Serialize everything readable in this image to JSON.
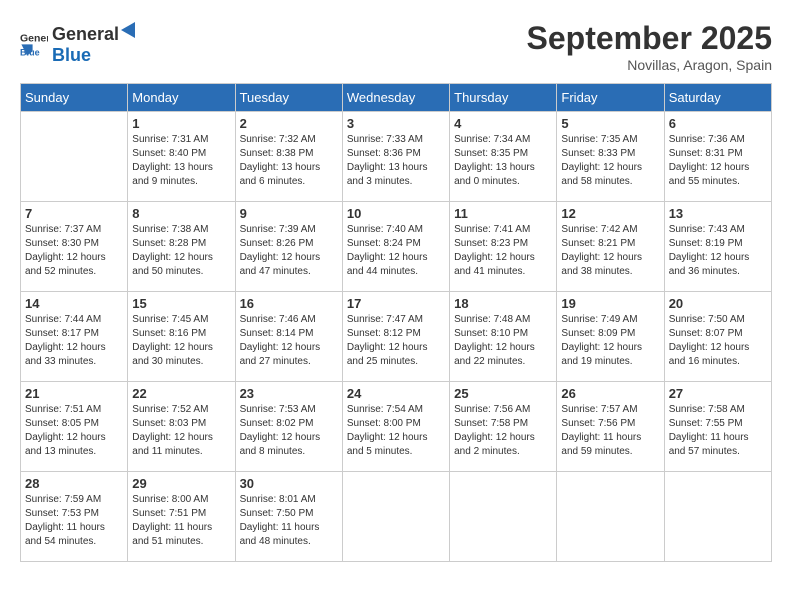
{
  "header": {
    "logo_general": "General",
    "logo_blue": "Blue",
    "month_title": "September 2025",
    "subtitle": "Novillas, Aragon, Spain"
  },
  "weekdays": [
    "Sunday",
    "Monday",
    "Tuesday",
    "Wednesday",
    "Thursday",
    "Friday",
    "Saturday"
  ],
  "weeks": [
    [
      {
        "day": "",
        "sunrise": "",
        "sunset": "",
        "daylight": ""
      },
      {
        "day": "1",
        "sunrise": "Sunrise: 7:31 AM",
        "sunset": "Sunset: 8:40 PM",
        "daylight": "Daylight: 13 hours and 9 minutes."
      },
      {
        "day": "2",
        "sunrise": "Sunrise: 7:32 AM",
        "sunset": "Sunset: 8:38 PM",
        "daylight": "Daylight: 13 hours and 6 minutes."
      },
      {
        "day": "3",
        "sunrise": "Sunrise: 7:33 AM",
        "sunset": "Sunset: 8:36 PM",
        "daylight": "Daylight: 13 hours and 3 minutes."
      },
      {
        "day": "4",
        "sunrise": "Sunrise: 7:34 AM",
        "sunset": "Sunset: 8:35 PM",
        "daylight": "Daylight: 13 hours and 0 minutes."
      },
      {
        "day": "5",
        "sunrise": "Sunrise: 7:35 AM",
        "sunset": "Sunset: 8:33 PM",
        "daylight": "Daylight: 12 hours and 58 minutes."
      },
      {
        "day": "6",
        "sunrise": "Sunrise: 7:36 AM",
        "sunset": "Sunset: 8:31 PM",
        "daylight": "Daylight: 12 hours and 55 minutes."
      }
    ],
    [
      {
        "day": "7",
        "sunrise": "Sunrise: 7:37 AM",
        "sunset": "Sunset: 8:30 PM",
        "daylight": "Daylight: 12 hours and 52 minutes."
      },
      {
        "day": "8",
        "sunrise": "Sunrise: 7:38 AM",
        "sunset": "Sunset: 8:28 PM",
        "daylight": "Daylight: 12 hours and 50 minutes."
      },
      {
        "day": "9",
        "sunrise": "Sunrise: 7:39 AM",
        "sunset": "Sunset: 8:26 PM",
        "daylight": "Daylight: 12 hours and 47 minutes."
      },
      {
        "day": "10",
        "sunrise": "Sunrise: 7:40 AM",
        "sunset": "Sunset: 8:24 PM",
        "daylight": "Daylight: 12 hours and 44 minutes."
      },
      {
        "day": "11",
        "sunrise": "Sunrise: 7:41 AM",
        "sunset": "Sunset: 8:23 PM",
        "daylight": "Daylight: 12 hours and 41 minutes."
      },
      {
        "day": "12",
        "sunrise": "Sunrise: 7:42 AM",
        "sunset": "Sunset: 8:21 PM",
        "daylight": "Daylight: 12 hours and 38 minutes."
      },
      {
        "day": "13",
        "sunrise": "Sunrise: 7:43 AM",
        "sunset": "Sunset: 8:19 PM",
        "daylight": "Daylight: 12 hours and 36 minutes."
      }
    ],
    [
      {
        "day": "14",
        "sunrise": "Sunrise: 7:44 AM",
        "sunset": "Sunset: 8:17 PM",
        "daylight": "Daylight: 12 hours and 33 minutes."
      },
      {
        "day": "15",
        "sunrise": "Sunrise: 7:45 AM",
        "sunset": "Sunset: 8:16 PM",
        "daylight": "Daylight: 12 hours and 30 minutes."
      },
      {
        "day": "16",
        "sunrise": "Sunrise: 7:46 AM",
        "sunset": "Sunset: 8:14 PM",
        "daylight": "Daylight: 12 hours and 27 minutes."
      },
      {
        "day": "17",
        "sunrise": "Sunrise: 7:47 AM",
        "sunset": "Sunset: 8:12 PM",
        "daylight": "Daylight: 12 hours and 25 minutes."
      },
      {
        "day": "18",
        "sunrise": "Sunrise: 7:48 AM",
        "sunset": "Sunset: 8:10 PM",
        "daylight": "Daylight: 12 hours and 22 minutes."
      },
      {
        "day": "19",
        "sunrise": "Sunrise: 7:49 AM",
        "sunset": "Sunset: 8:09 PM",
        "daylight": "Daylight: 12 hours and 19 minutes."
      },
      {
        "day": "20",
        "sunrise": "Sunrise: 7:50 AM",
        "sunset": "Sunset: 8:07 PM",
        "daylight": "Daylight: 12 hours and 16 minutes."
      }
    ],
    [
      {
        "day": "21",
        "sunrise": "Sunrise: 7:51 AM",
        "sunset": "Sunset: 8:05 PM",
        "daylight": "Daylight: 12 hours and 13 minutes."
      },
      {
        "day": "22",
        "sunrise": "Sunrise: 7:52 AM",
        "sunset": "Sunset: 8:03 PM",
        "daylight": "Daylight: 12 hours and 11 minutes."
      },
      {
        "day": "23",
        "sunrise": "Sunrise: 7:53 AM",
        "sunset": "Sunset: 8:02 PM",
        "daylight": "Daylight: 12 hours and 8 minutes."
      },
      {
        "day": "24",
        "sunrise": "Sunrise: 7:54 AM",
        "sunset": "Sunset: 8:00 PM",
        "daylight": "Daylight: 12 hours and 5 minutes."
      },
      {
        "day": "25",
        "sunrise": "Sunrise: 7:56 AM",
        "sunset": "Sunset: 7:58 PM",
        "daylight": "Daylight: 12 hours and 2 minutes."
      },
      {
        "day": "26",
        "sunrise": "Sunrise: 7:57 AM",
        "sunset": "Sunset: 7:56 PM",
        "daylight": "Daylight: 11 hours and 59 minutes."
      },
      {
        "day": "27",
        "sunrise": "Sunrise: 7:58 AM",
        "sunset": "Sunset: 7:55 PM",
        "daylight": "Daylight: 11 hours and 57 minutes."
      }
    ],
    [
      {
        "day": "28",
        "sunrise": "Sunrise: 7:59 AM",
        "sunset": "Sunset: 7:53 PM",
        "daylight": "Daylight: 11 hours and 54 minutes."
      },
      {
        "day": "29",
        "sunrise": "Sunrise: 8:00 AM",
        "sunset": "Sunset: 7:51 PM",
        "daylight": "Daylight: 11 hours and 51 minutes."
      },
      {
        "day": "30",
        "sunrise": "Sunrise: 8:01 AM",
        "sunset": "Sunset: 7:50 PM",
        "daylight": "Daylight: 11 hours and 48 minutes."
      },
      {
        "day": "",
        "sunrise": "",
        "sunset": "",
        "daylight": ""
      },
      {
        "day": "",
        "sunrise": "",
        "sunset": "",
        "daylight": ""
      },
      {
        "day": "",
        "sunrise": "",
        "sunset": "",
        "daylight": ""
      },
      {
        "day": "",
        "sunrise": "",
        "sunset": "",
        "daylight": ""
      }
    ]
  ]
}
